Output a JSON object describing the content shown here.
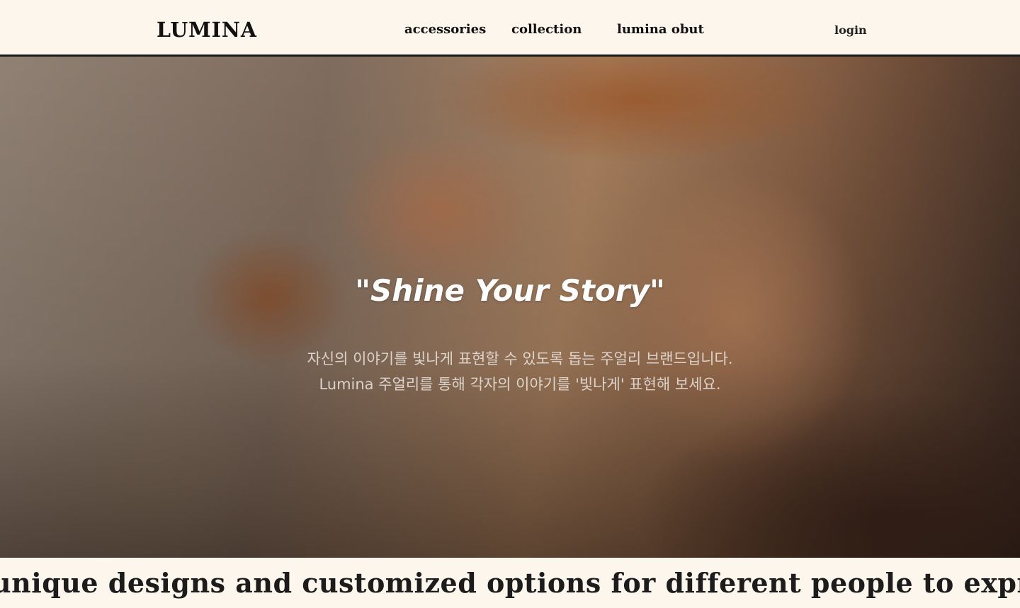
{
  "header": {
    "logo": "LUMINA",
    "nav": {
      "accessories": "accessories",
      "collection": "collection",
      "about": "lumina obut"
    },
    "login": "login"
  },
  "hero": {
    "title": "\"Shine Your Story\"",
    "line1": "자신의 이야기를 빛나게 표현할 수 있도록 돕는 주얼리 브랜드입니다.",
    "line2": "Lumina 주얼리를 통해 각자의 이야기를 '빛나게' 표현해 보세요."
  },
  "marquee": {
    "text": "unique designs and customized options for different people to express"
  }
}
